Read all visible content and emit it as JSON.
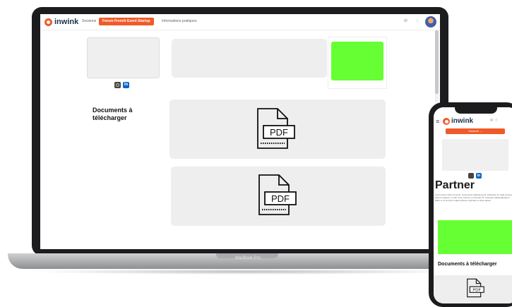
{
  "app": {
    "brand": "inwink",
    "nav": [
      "Sessions",
      "Forum French Event Startup",
      "Informations pratiques"
    ],
    "nav_active_index": 1,
    "nav_active_label": "Forum French Event Startup",
    "header_icons": [
      "sign-in-icon",
      "bell-icon",
      "avatar"
    ]
  },
  "main": {
    "social": [
      "website-icon",
      "linkedin-icon"
    ],
    "linkedin_label": "in",
    "documents_title": "Documents à télécharger",
    "documents": [
      {
        "label": "PDF",
        "icon": "pdf-file-icon"
      },
      {
        "label": "PDF",
        "icon": "pdf-file-icon"
      }
    ]
  },
  "device": {
    "laptop_label": "MacBook Pro"
  },
  "mobile": {
    "brand": "inwink",
    "button_label": "Subsmit →",
    "title": "Partner",
    "lorem": "Lorem ipsum dolor sit amet, consectetur adipiscing elit. Phasellus ac nulla venenatis dolor eu aliquet. In nibh urna, viverra in commodo id, vehicula malesuada libero. Etiam a mi sit amet magna ultrices vulputate et vitae sapien.",
    "documents_title": "Documents à télécharger",
    "doc_label": "PDF"
  },
  "colors": {
    "accent": "#f05a28",
    "green_block": "#66ff33",
    "card_bg": "#eeeeee",
    "linkedin": "#0a66c2"
  }
}
